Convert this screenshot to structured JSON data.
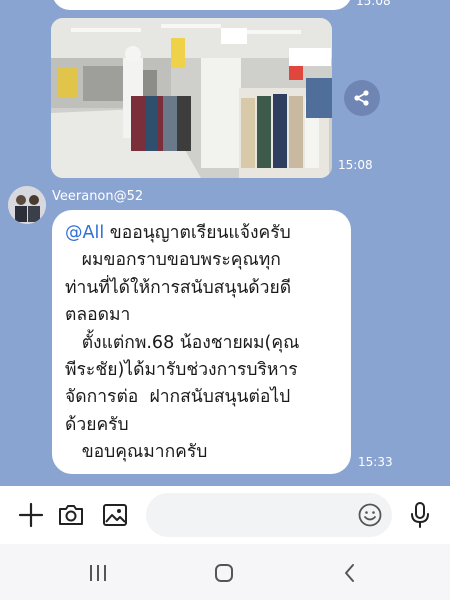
{
  "chat": {
    "prev_time": "15:08",
    "photo_time": "15:08",
    "sender_name": "Veeranon@52",
    "message": {
      "mention": "@All",
      "lines": [
        " ขออนุญาตเรียนแจ้งครับ",
        "   ผมขอกราบขอบพระคุณทุก",
        "ท่านที่ได้ให้การสนับสนุนด้วยดี",
        "ตลอดมา",
        "   ตั้งแต่กพ.68 น้องชายผม(คุณ",
        "พีระชัย)ได้มารับช่วงการบริหาร",
        "จัดการต่อ  ฝากสนับสนุนต่อไป",
        "ด้วยครับ",
        "   ขอบคุณมากครับ"
      ],
      "time": "15:33"
    }
  },
  "input": {
    "placeholder": "",
    "value": ""
  },
  "icons": {
    "add": "plus-icon",
    "camera": "camera-icon",
    "gallery": "image-icon",
    "emoji": "smiley-icon",
    "mic": "microphone-icon",
    "share": "share-icon"
  },
  "colors": {
    "chat_bg": "#8aa4d2",
    "bubble": "#ffffff",
    "mention": "#2f6fd6"
  }
}
